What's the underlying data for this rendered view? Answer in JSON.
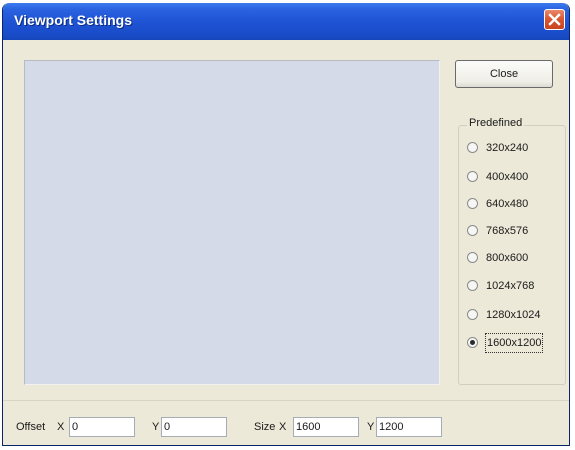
{
  "window": {
    "title": "Viewport Settings"
  },
  "buttons": {
    "close_label": "Close"
  },
  "predefined": {
    "label": "Predefined",
    "options": [
      {
        "label": "320x240",
        "selected": false
      },
      {
        "label": "400x400",
        "selected": false
      },
      {
        "label": "640x480",
        "selected": false
      },
      {
        "label": "768x576",
        "selected": false
      },
      {
        "label": "800x600",
        "selected": false
      },
      {
        "label": "1024x768",
        "selected": false
      },
      {
        "label": "1280x1024",
        "selected": false
      },
      {
        "label": "1600x1200",
        "selected": true
      }
    ]
  },
  "status": {
    "offset_label": "Offset",
    "offset_x_label": "X",
    "offset_x_value": "0",
    "offset_y_label": "Y",
    "offset_y_value": "0",
    "size_label": "Size",
    "size_x_label": "X",
    "size_x_value": "1600",
    "size_y_label": "Y",
    "size_y_value": "1200"
  },
  "colors": {
    "titlebar": "#1d52d3",
    "viewport": "#d5dae8",
    "dialog": "#ece9d8",
    "close_x": "#d8552e"
  },
  "icons": {
    "title_close": "close-icon"
  }
}
